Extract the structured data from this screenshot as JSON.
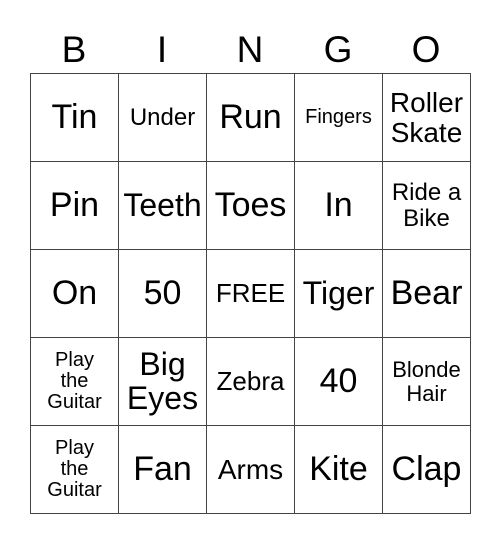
{
  "header": [
    "B",
    "I",
    "N",
    "G",
    "O"
  ],
  "cells": [
    [
      "Tin",
      "Under",
      "Run",
      "Fingers",
      "Roller\nSkate"
    ],
    [
      "Pin",
      "Teeth",
      "Toes",
      "In",
      "Ride a\nBike"
    ],
    [
      "On",
      "50",
      "FREE",
      "Tiger",
      "Bear"
    ],
    [
      "Play\nthe\nGuitar",
      "Big\nEyes",
      "Zebra",
      "40",
      "Blonde\nHair"
    ],
    [
      "Play\nthe\nGuitar",
      "Fan",
      "Arms",
      "Kite",
      "Clap"
    ]
  ]
}
